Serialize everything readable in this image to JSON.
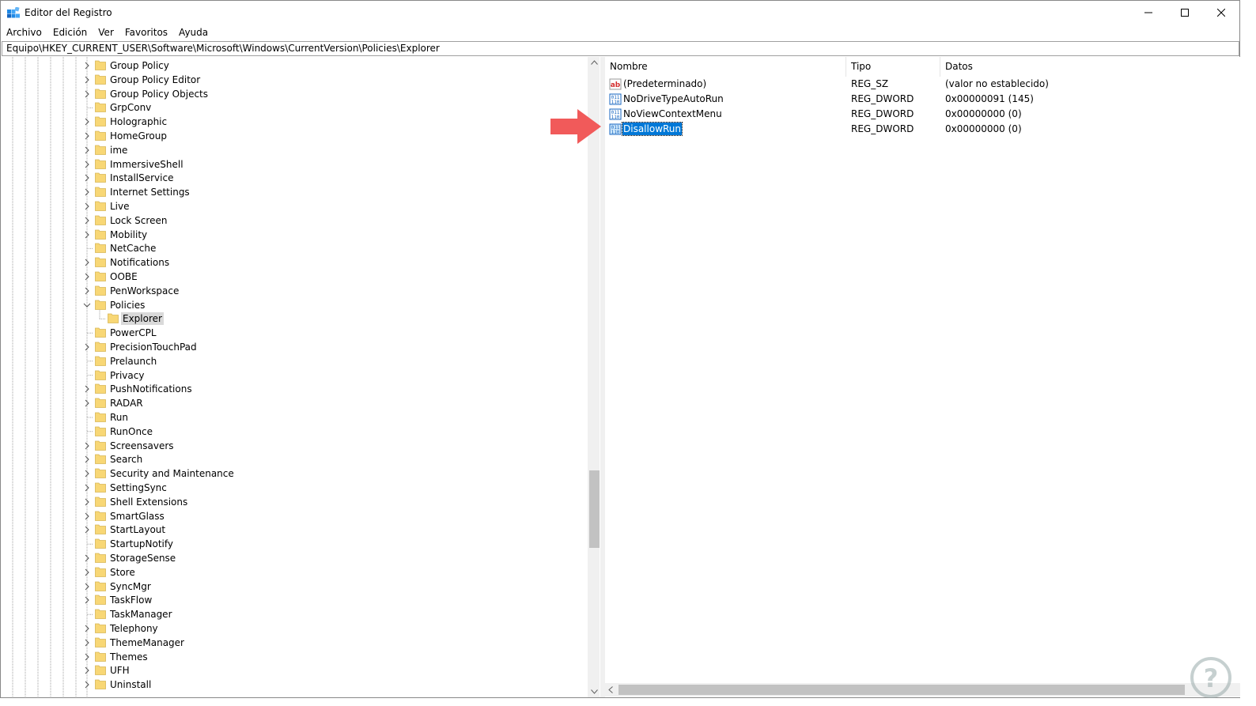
{
  "window": {
    "title": "Editor del Registro",
    "minimize_label": "minimize",
    "maximize_label": "maximize",
    "close_label": "close"
  },
  "menu": {
    "items": [
      "Archivo",
      "Edición",
      "Ver",
      "Favoritos",
      "Ayuda"
    ]
  },
  "address": {
    "path": "Equipo\\HKEY_CURRENT_USER\\Software\\Microsoft\\Windows\\CurrentVersion\\Policies\\Explorer"
  },
  "tree": {
    "items": [
      {
        "label": "Group Policy",
        "expandable": true
      },
      {
        "label": "Group Policy Editor",
        "expandable": true
      },
      {
        "label": "Group Policy Objects",
        "expandable": true
      },
      {
        "label": "GrpConv",
        "expandable": false
      },
      {
        "label": "Holographic",
        "expandable": true
      },
      {
        "label": "HomeGroup",
        "expandable": true
      },
      {
        "label": "ime",
        "expandable": true
      },
      {
        "label": "ImmersiveShell",
        "expandable": true
      },
      {
        "label": "InstallService",
        "expandable": true
      },
      {
        "label": "Internet Settings",
        "expandable": true
      },
      {
        "label": "Live",
        "expandable": true
      },
      {
        "label": "Lock Screen",
        "expandable": true
      },
      {
        "label": "Mobility",
        "expandable": true
      },
      {
        "label": "NetCache",
        "expandable": false
      },
      {
        "label": "Notifications",
        "expandable": true
      },
      {
        "label": "OOBE",
        "expandable": true
      },
      {
        "label": "PenWorkspace",
        "expandable": true
      },
      {
        "label": "Policies",
        "expandable": true,
        "expanded": true
      },
      {
        "label": "Explorer",
        "expandable": false,
        "child": true,
        "selected": true
      },
      {
        "label": "PowerCPL",
        "expandable": false
      },
      {
        "label": "PrecisionTouchPad",
        "expandable": true
      },
      {
        "label": "Prelaunch",
        "expandable": false
      },
      {
        "label": "Privacy",
        "expandable": false
      },
      {
        "label": "PushNotifications",
        "expandable": true
      },
      {
        "label": "RADAR",
        "expandable": true
      },
      {
        "label": "Run",
        "expandable": false
      },
      {
        "label": "RunOnce",
        "expandable": false
      },
      {
        "label": "Screensavers",
        "expandable": true
      },
      {
        "label": "Search",
        "expandable": true
      },
      {
        "label": "Security and Maintenance",
        "expandable": true
      },
      {
        "label": "SettingSync",
        "expandable": true
      },
      {
        "label": "Shell Extensions",
        "expandable": true
      },
      {
        "label": "SmartGlass",
        "expandable": true
      },
      {
        "label": "StartLayout",
        "expandable": true
      },
      {
        "label": "StartupNotify",
        "expandable": false
      },
      {
        "label": "StorageSense",
        "expandable": true
      },
      {
        "label": "Store",
        "expandable": true
      },
      {
        "label": "SyncMgr",
        "expandable": true
      },
      {
        "label": "TaskFlow",
        "expandable": true
      },
      {
        "label": "TaskManager",
        "expandable": false
      },
      {
        "label": "Telephony",
        "expandable": true
      },
      {
        "label": "ThemeManager",
        "expandable": true
      },
      {
        "label": "Themes",
        "expandable": true
      },
      {
        "label": "UFH",
        "expandable": true
      },
      {
        "label": "Uninstall",
        "expandable": true
      }
    ]
  },
  "values": {
    "columns": {
      "name": "Nombre",
      "type": "Tipo",
      "data": "Datos"
    },
    "rows": [
      {
        "name": "(Predeterminado)",
        "type": "REG_SZ",
        "data": "(valor no establecido)",
        "icon": "string-value-icon",
        "selected": false
      },
      {
        "name": "NoDriveTypeAutoRun",
        "type": "REG_DWORD",
        "data": "0x00000091 (145)",
        "icon": "binary-value-icon",
        "selected": false
      },
      {
        "name": "NoViewContextMenu",
        "type": "REG_DWORD",
        "data": "0x00000000 (0)",
        "icon": "binary-value-icon",
        "selected": false
      },
      {
        "name": "DisallowRun",
        "type": "REG_DWORD",
        "data": "0x00000000 (0)",
        "icon": "binary-value-icon",
        "selected": true
      }
    ]
  },
  "colors": {
    "selection_blue": "#0078d7",
    "tree_selection_gray": "#d9d9d9",
    "annotation_arrow": "#f15a5a",
    "folder_yellow": "#f8d775"
  }
}
